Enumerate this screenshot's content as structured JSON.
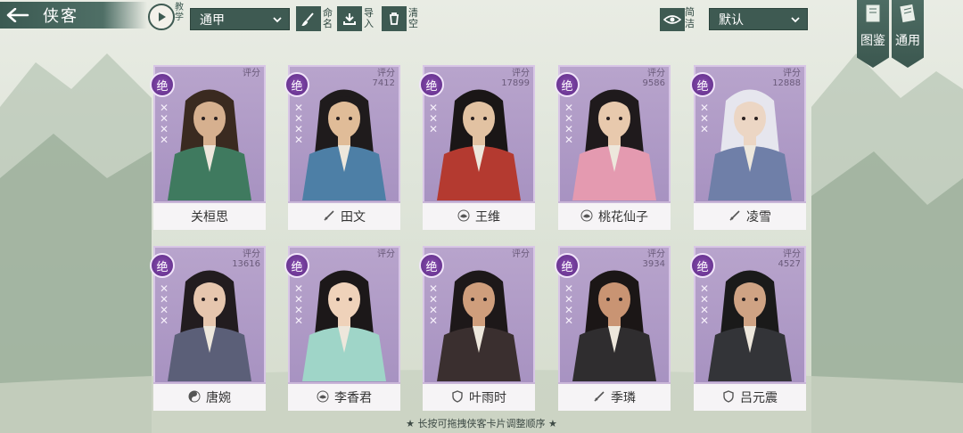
{
  "header": {
    "back_icon": "back-arrow-icon",
    "title": "侠客",
    "tutorial_label": "教学",
    "filter_value": "通甲",
    "rename_label": "命名",
    "import_label": "导入",
    "clear_label": "清空",
    "concise_label": "简洁",
    "sort_value": "默认"
  },
  "side_tabs": [
    {
      "label": "图鉴",
      "icon": "book-icon"
    },
    {
      "label": "通用",
      "icon": "scroll-icon"
    }
  ],
  "colors": {
    "accent": "#3e5a52",
    "card": "#a892c2",
    "badge": "#6b3594"
  },
  "cards": [
    {
      "name": "关桓思",
      "score_label": "评分",
      "score": "",
      "grade": "绝",
      "class_icon": "none",
      "marks": 4
    },
    {
      "name": "田文",
      "score_label": "评分",
      "score": "7412",
      "grade": "绝",
      "class_icon": "sword-icon",
      "marks": 4
    },
    {
      "name": "王维",
      "score_label": "评分",
      "score": "17899",
      "grade": "绝",
      "class_icon": "lotus-icon",
      "marks": 3
    },
    {
      "name": "桃花仙子",
      "score_label": "评分",
      "score": "9586",
      "grade": "绝",
      "class_icon": "lotus-icon",
      "marks": 4
    },
    {
      "name": "凌雪",
      "score_label": "评分",
      "score": "12888",
      "grade": "绝",
      "class_icon": "sword-icon",
      "marks": 3
    },
    {
      "name": "唐婉",
      "score_label": "评分",
      "score": "13616",
      "grade": "绝",
      "class_icon": "taiji-icon",
      "marks": 4
    },
    {
      "name": "李香君",
      "score_label": "评分",
      "score": "",
      "grade": "绝",
      "class_icon": "lotus-icon",
      "marks": 4
    },
    {
      "name": "叶雨时",
      "score_label": "评分",
      "score": "",
      "grade": "绝",
      "class_icon": "shield-icon",
      "marks": 4
    },
    {
      "name": "季璘",
      "score_label": "评分",
      "score": "3934",
      "grade": "绝",
      "class_icon": "sword-icon",
      "marks": 4
    },
    {
      "name": "吕元震",
      "score_label": "评分",
      "score": "4527",
      "grade": "绝",
      "class_icon": "shield-icon",
      "marks": 4
    }
  ],
  "footer": {
    "hint": "★ 长按可拖拽侠客卡片调整顺序 ★"
  }
}
